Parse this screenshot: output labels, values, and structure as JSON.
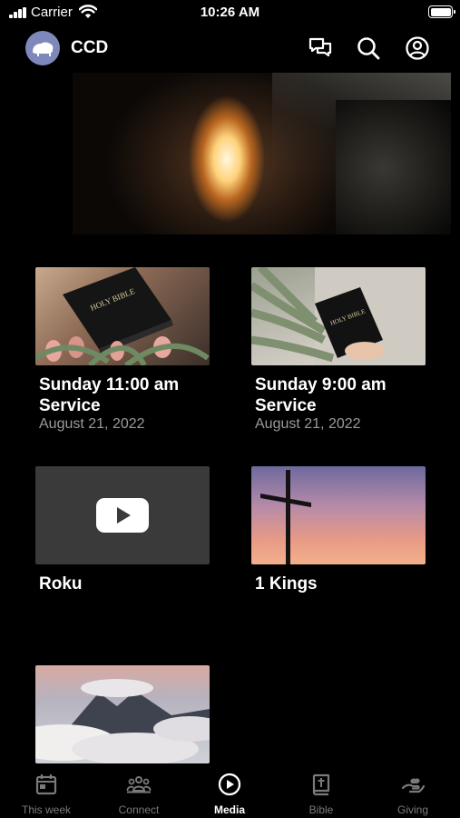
{
  "status_bar": {
    "carrier": "Carrier",
    "time": "10:26 AM"
  },
  "header": {
    "title": "CCD"
  },
  "cards": [
    {
      "title": "Sunday 11:00 am Service",
      "date": "August 21, 2022",
      "thumb": "holy-bible-tulips-image"
    },
    {
      "title": "Sunday 9:00 am Service",
      "date": "August 21, 2022",
      "thumb": "person-holding-bible-image"
    },
    {
      "title": "Roku",
      "date": "",
      "thumb": "youtube-play-icon"
    },
    {
      "title": "1 Kings",
      "date": "",
      "thumb": "cross-sunset-image"
    },
    {
      "title": "",
      "date": "",
      "thumb": "mountain-clouds-image"
    }
  ],
  "tabs": [
    {
      "label": "This week",
      "icon": "calendar-icon",
      "active": false
    },
    {
      "label": "Connect",
      "icon": "people-icon",
      "active": false
    },
    {
      "label": "Media",
      "icon": "play-circle-icon",
      "active": true
    },
    {
      "label": "Bible",
      "icon": "bible-icon",
      "active": false
    },
    {
      "label": "Giving",
      "icon": "giving-hand-icon",
      "active": false
    }
  ],
  "colors": {
    "background": "#000000",
    "logo": "#7f88bb",
    "inactive_tab": "#7a7a7a",
    "date_text": "#9a9a9a"
  }
}
